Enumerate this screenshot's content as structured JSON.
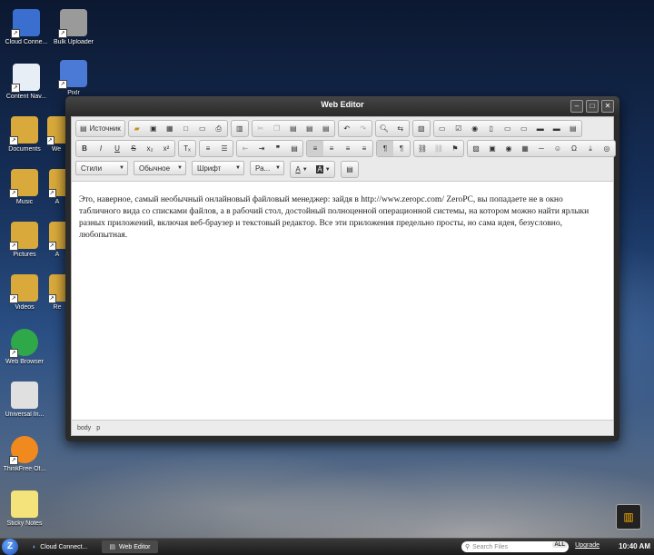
{
  "desktop": {
    "icons": [
      {
        "label": "Cloud Conne...",
        "icon": "cloud-connect-icon",
        "color": "#3a6fd0"
      },
      {
        "label": "Bulk Uploader",
        "icon": "bulk-uploader-icon",
        "color": "#9a9a9a"
      },
      {
        "label": "Content Nav...",
        "icon": "content-nav-icon",
        "color": "#e8eef6"
      },
      {
        "label": "Pixlr",
        "icon": "pixlr-icon",
        "color": "#4b79d6"
      },
      {
        "label": "Documents",
        "icon": "documents-folder-icon",
        "color": "#d9a93b"
      },
      {
        "label": "We",
        "icon": "web-folder-icon",
        "color": "#d9a93b"
      },
      {
        "label": "Music",
        "icon": "music-folder-icon",
        "color": "#d9a93b"
      },
      {
        "label": "A",
        "icon": "app-folder-icon",
        "color": "#d9a93b"
      },
      {
        "label": "Pictures",
        "icon": "pictures-folder-icon",
        "color": "#d9a93b"
      },
      {
        "label": "A",
        "icon": "app-folder-icon",
        "color": "#d9a93b"
      },
      {
        "label": "Videos",
        "icon": "videos-folder-icon",
        "color": "#d9a93b"
      },
      {
        "label": "Re",
        "icon": "recent-folder-icon",
        "color": "#d9a93b"
      },
      {
        "label": "Web Browser",
        "icon": "web-browser-icon",
        "color": "#2fa84a"
      },
      {
        "label": "Universal In...",
        "icon": "universal-inbox-icon",
        "color": "#e0e0e0"
      },
      {
        "label": "ThinkFree Of...",
        "icon": "thinkfree-office-icon",
        "color": "#f08a1e"
      },
      {
        "label": "Sticky Notes",
        "icon": "sticky-notes-icon",
        "color": "#f4e37a"
      }
    ]
  },
  "window": {
    "title": "Web Editor",
    "toolbar": {
      "source_label": "Источник",
      "styles_label": "Стили",
      "format_label": "Обычное",
      "font_label": "Шрифт",
      "size_label": "Ра..."
    },
    "content": "Это, наверное, самый необычный онлайновый файловый менеджер: зайдя в http://www.zeropc.com/ ZeroPC, вы попадаете не в окно табличного вида со списками файлов, а в рабочий стол, достойный полноценной операционной системы, на котором можно найти ярлыки разных приложений, включая веб-браузер и текстовый редактор. Все эти приложения предельно просты, но сама идея, безусловно, любопытная.",
    "path": [
      "body",
      "p"
    ]
  },
  "taskbar": {
    "tasks": [
      {
        "label": "Cloud Connect...",
        "icon": "cloud-connect-icon"
      },
      {
        "label": "Web Editor",
        "icon": "web-editor-icon"
      }
    ],
    "search_placeholder": "Search Files",
    "search_scope": "ALL",
    "upgrade_label": "Upgrade",
    "clock": "10:40 AM"
  }
}
